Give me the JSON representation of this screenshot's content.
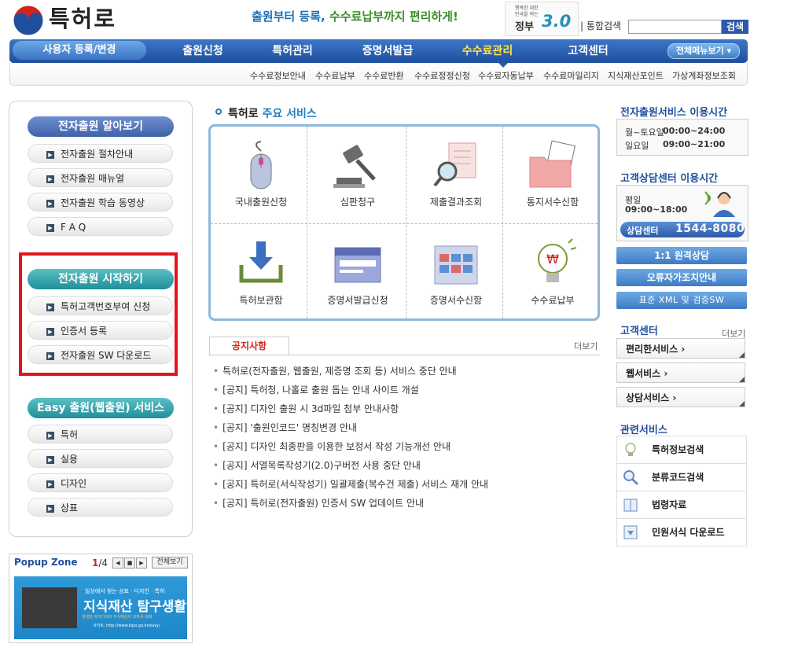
{
  "header": {
    "logo_text": "특허로",
    "slogan_part1": "출원부터 등록, ",
    "slogan_part2": "수수료납부까지 편리하게!",
    "gov_small": "행복한 대한민국을 여는",
    "gov_name": "정부",
    "gov_version": "3.0",
    "search_label": "| 통합검색",
    "search_value": "",
    "search_button": "검색"
  },
  "nav": {
    "user_label": "사용자 등록/변경",
    "items": [
      "출원신청",
      "특허관리",
      "증명서발급",
      "수수료관리",
      "고객센터"
    ],
    "active": "수수료관리",
    "all_menu": "전체메뉴보기",
    "sub_items": [
      "수수료정보안내",
      "수수료납부",
      "수수료반환",
      "수수료정정신청",
      "수수료자동납부",
      "수수료마일리지",
      "지식재산포인트",
      "가상계좌정보조회"
    ]
  },
  "left": {
    "sections": [
      {
        "title": "전자출원 알아보기",
        "items": [
          "전자출원 절차안내",
          "전자출원 매뉴얼",
          "전자출원 학습 동영상",
          "F A Q"
        ]
      },
      {
        "title": "전자출원 시작하기",
        "items": [
          "특허고객번호부여 신청",
          "인증서 등록",
          "전자출원 SW 다운로드"
        ]
      },
      {
        "title": "Easy 출원(웹출원) 서비스",
        "items": [
          "특허",
          "실용",
          "디자인",
          "상표"
        ]
      }
    ]
  },
  "popup": {
    "title": "Popup Zone",
    "page_current": "1",
    "page_total": "/4",
    "all_button": "전체보기",
    "banner_small": "일상에서 찾는 상표 · 디자인 · 특허",
    "banner_title": "지식재산 탐구생활",
    "banner_desc": "생생한 아이디어와 지식재산이 교과서 속에",
    "banner_url": "사이트: http://www.kipo.go.kr/easy/"
  },
  "services": {
    "title_prefix": "특허로",
    "title_highlight": "주요 서비스",
    "items": [
      "국내출원신청",
      "심판청구",
      "제출결과조회",
      "통지서수신함",
      "특허보관함",
      "증명서발급신청",
      "증명서수신함",
      "수수료납부"
    ]
  },
  "notices": {
    "tab": "공지사항",
    "more": "더보기",
    "items": [
      "특허로(전자출원, 웹출원, 제증명 조회 등) 서비스 중단 안내",
      "[공지] 특허청, 나홀로 출원 돕는 안내 사이트 개설",
      "[공지] 디자인 출원 시 3d파일 첨부 안내사항",
      "[공지] '출원인코드' 명칭변경 안내",
      "[공지] 디자인 최종판을 이용한 보정서 작성 기능개선 안내",
      "[공지] 서열목록작성기(2.0)구버전 사용 중단 안내",
      "[공지] 특허로(서식작성기) 일괄제출(복수건 제출) 서비스 재개 안내",
      "[공지] 특허로(전자출원) 인증서 SW 업데이트 안내"
    ]
  },
  "right": {
    "hours_title": "전자출원서비스 이용시간",
    "hours": [
      {
        "day": "월~토요일",
        "time": "00:00~24:00"
      },
      {
        "day": "일요일",
        "time": "09:00~21:00"
      }
    ],
    "cs_title": "고객상담센터 이용시간",
    "cs_day": "평일",
    "cs_time": "09:00~18:00",
    "cs_center": "상담센터",
    "cs_phone": "1544-8080",
    "buttons": [
      "1:1 원격상담",
      "오류자가조치안내",
      "표준 XML 및 검증SW"
    ],
    "center_title": "고객센터",
    "center_more": "더보기",
    "center_items": [
      "편리한서비스 ›",
      "웹서비스 ›",
      "상담서비스 ›"
    ],
    "related_title": "관련서비스",
    "related_items": [
      "특허정보검색",
      "분류코드검색",
      "법령자료",
      "민원서식 다운로드"
    ]
  },
  "colors": {
    "nav_blue": "#1f4f9e",
    "accent_yellow": "#ffe34d",
    "highlight_red": "#e5131b",
    "teal": "#1f8f9a"
  }
}
